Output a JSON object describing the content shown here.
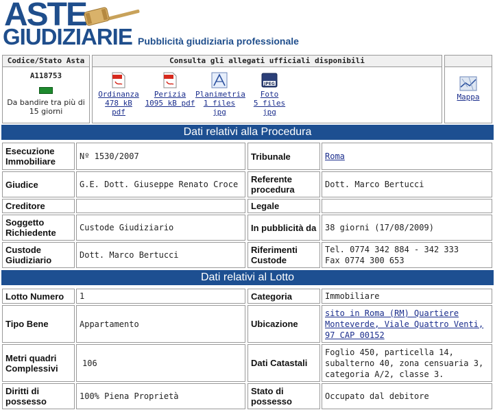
{
  "header": {
    "logo_line1": "ASTE",
    "logo_line2": "GIUDIZIARIE",
    "tagline": "Pubblicità giudiziaria professionale"
  },
  "asta": {
    "head": "Codice/Stato Asta",
    "code": "A118753",
    "status_color": "#1e8a2e",
    "status_text": "Da bandire tra più di 15 giorni"
  },
  "allegati": {
    "head": "Consulta gli allegati ufficiali disponibili",
    "items": [
      {
        "icon": "pdf-icon",
        "name": "Ordinanza",
        "info": "478 kB pdf"
      },
      {
        "icon": "pdf-icon",
        "name": "Perizia",
        "info": "1095 kB pdf"
      },
      {
        "icon": "plan-icon",
        "name": "Planimetria",
        "info": "1 files jpg"
      },
      {
        "icon": "jpeg-icon",
        "name": "Foto",
        "info": "5 files jpg"
      }
    ]
  },
  "map": {
    "label": "Mappa"
  },
  "procedura": {
    "title": "Dati relativi alla Procedura",
    "rows": [
      {
        "l1": "Esecuzione Immobiliare",
        "v1": "Nº 1530/2007",
        "l2": "Tribunale",
        "v2": "Roma"
      },
      {
        "l1": "Giudice",
        "v1": "G.E. Dott. Giuseppe Renato Croce",
        "l2": "Referente procedura",
        "v2": "Dott. Marco Bertucci"
      },
      {
        "l1": "Creditore",
        "v1": "",
        "l2": "Legale",
        "v2": ""
      },
      {
        "l1": "Soggetto Richiedente",
        "v1": "Custode Giudiziario",
        "l2": "In pubblicità da",
        "v2": "38 giorni (17/08/2009)"
      },
      {
        "l1": "Custode Giudiziario",
        "v1": "Dott. Marco Bertucci",
        "l2": "Riferimenti Custode",
        "v2": "Tel. 0774 342 884 - 342 333\nFax 0774 300 653"
      }
    ]
  },
  "lotto": {
    "title": "Dati relativi al Lotto",
    "rows": [
      {
        "l1": "Lotto Numero",
        "v1": "1",
        "l2": "Categoria",
        "v2": "Immobiliare"
      },
      {
        "l1": "Tipo Bene",
        "v1": "Appartamento",
        "l2": "Ubicazione",
        "v2": "sito in Roma (RM) Quartiere Monteverde, Viale Quattro Venti, 97 CAP 00152"
      },
      {
        "l1": "Metri quadri Complessivi",
        "v1": "106",
        "l2": "Dati Catastali",
        "v2": "Foglio 450, particella 14, subalterno 40, zona censuaria 3, categoria A/2, classe 3."
      },
      {
        "l1": "Diritti di possesso",
        "v1": "100% Piena Proprietà",
        "l2": "Stato di possesso",
        "v2": "Occupato dal debitore"
      }
    ]
  }
}
